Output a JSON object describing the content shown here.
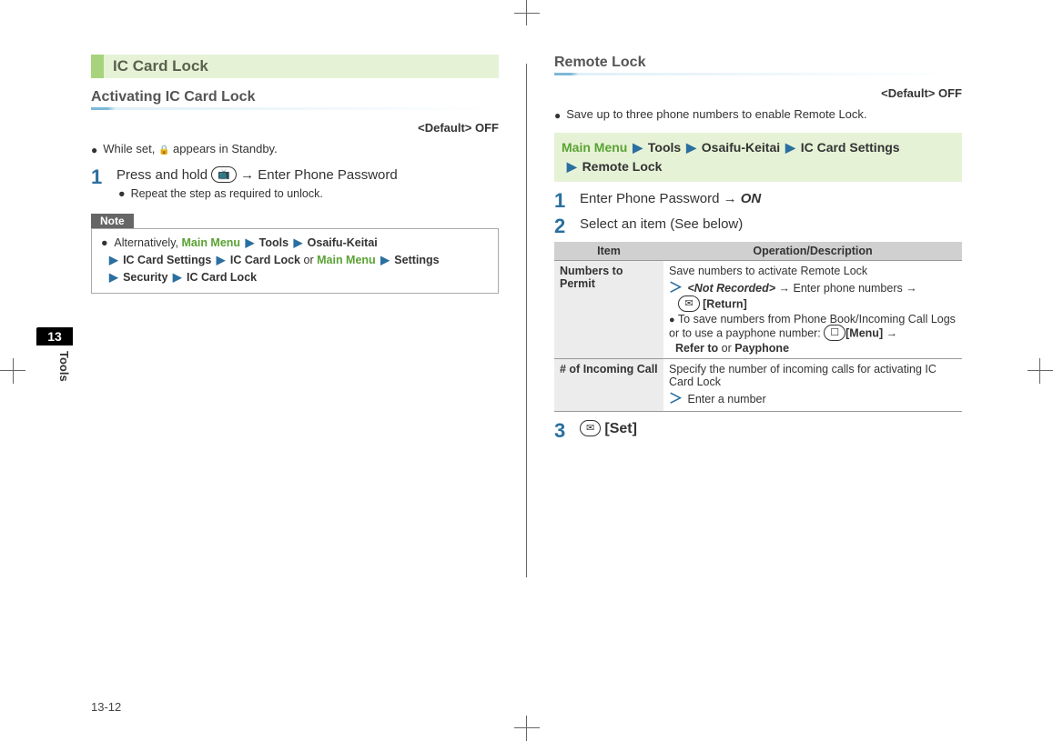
{
  "tab": {
    "number": "13",
    "label": "Tools"
  },
  "page_number": "13-12",
  "left": {
    "section_title": "IC Card Lock",
    "subsection_title": "Activating IC Card Lock",
    "default_label": "<Default> OFF",
    "bullet_set": "While set,",
    "bullet_set_suffix": "appears in Standby.",
    "step1": {
      "text_a": "Press and hold",
      "text_b": "→ Enter Phone Password",
      "sub": "Repeat the step as required to unlock."
    },
    "note_label": "Note",
    "note": {
      "prefix": "Alternatively,",
      "path1": {
        "a": "Main Menu",
        "b": "Tools",
        "c": "Osaifu-Keitai",
        "d": "IC Card Settings",
        "e": "IC Card Lock"
      },
      "or": "or",
      "path2": {
        "a": "Main Menu",
        "b": "Settings",
        "c": "Security",
        "d": "IC Card Lock"
      }
    }
  },
  "right": {
    "section_title": "Remote Lock",
    "default_label": "<Default> OFF",
    "bullet": "Save up to three phone numbers to enable Remote Lock.",
    "menu_path": {
      "a": "Main Menu",
      "b": "Tools",
      "c": "Osaifu-Keitai",
      "d": "IC Card Settings",
      "e": "Remote Lock"
    },
    "step1": {
      "text_a": "Enter Phone Password →",
      "on": "ON"
    },
    "step2": {
      "text": "Select an item (See below)"
    },
    "table": {
      "h1": "Item",
      "h2": "Operation/Description",
      "rows": [
        {
          "item": "Numbers to Permit",
          "desc_line1": "Save numbers to activate Remote Lock",
          "not_recorded": "<Not Recorded>",
          "desc_line2_a": "→ Enter phone numbers →",
          "return_btn": "[Return]",
          "desc_b1": "To save numbers from Phone Book/Incoming Call Logs or to use a payphone number:",
          "menu_btn": "[Menu]",
          "desc_b2": "→",
          "refer": "Refer to",
          "or": "or",
          "payphone": "Payphone"
        },
        {
          "item": "# of Incoming Call",
          "desc_line1": "Specify the number of incoming calls for activating IC Card Lock",
          "desc_line2": "Enter a number"
        }
      ]
    },
    "step3": {
      "set_btn": "[Set]"
    }
  }
}
